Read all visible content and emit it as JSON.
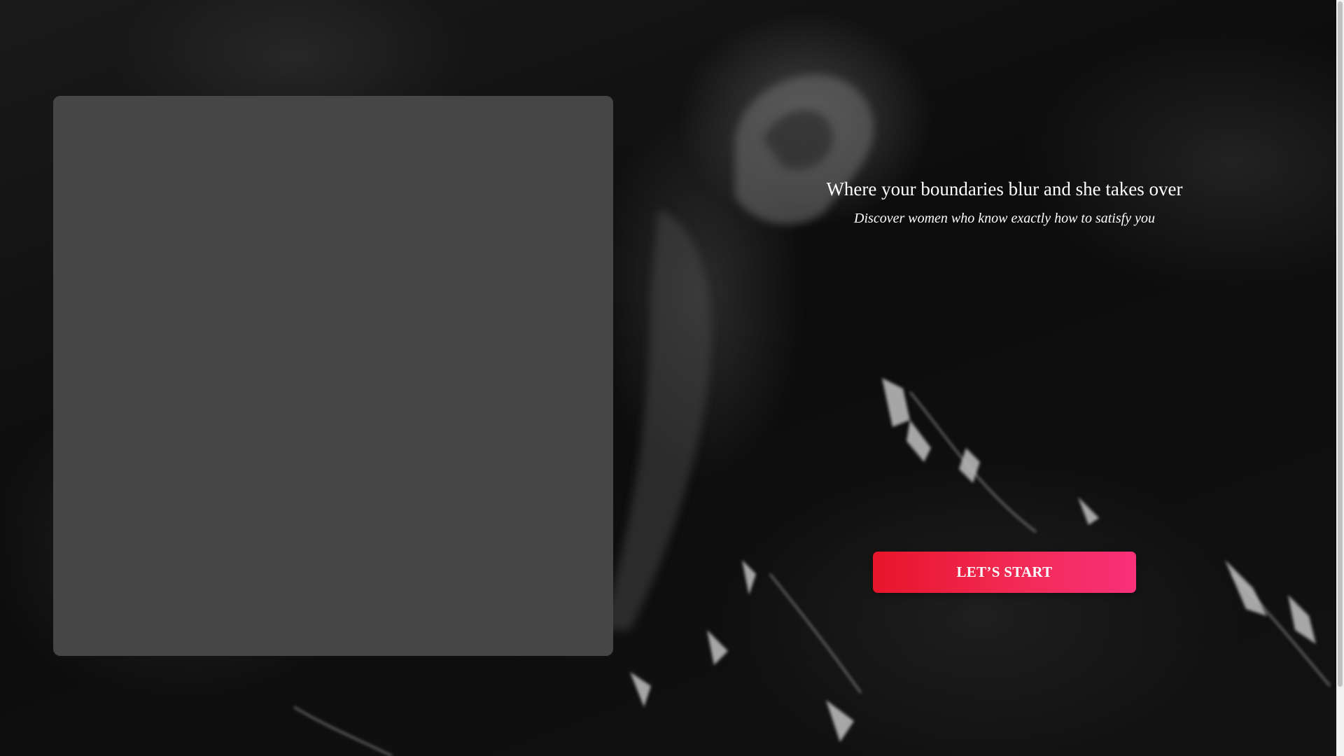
{
  "hero": {
    "title": "Where your boundaries blur and she takes over",
    "subtitle": "Discover women who know exactly how to satisfy you"
  },
  "cta": {
    "label": "LET’S START"
  },
  "colors": {
    "cta_start": "#e8152b",
    "cta_end": "#f8317a",
    "placeholder_panel": "#464646",
    "background": "#0b0b0b"
  },
  "scrollbar": {
    "visible_fraction": 0.91
  }
}
